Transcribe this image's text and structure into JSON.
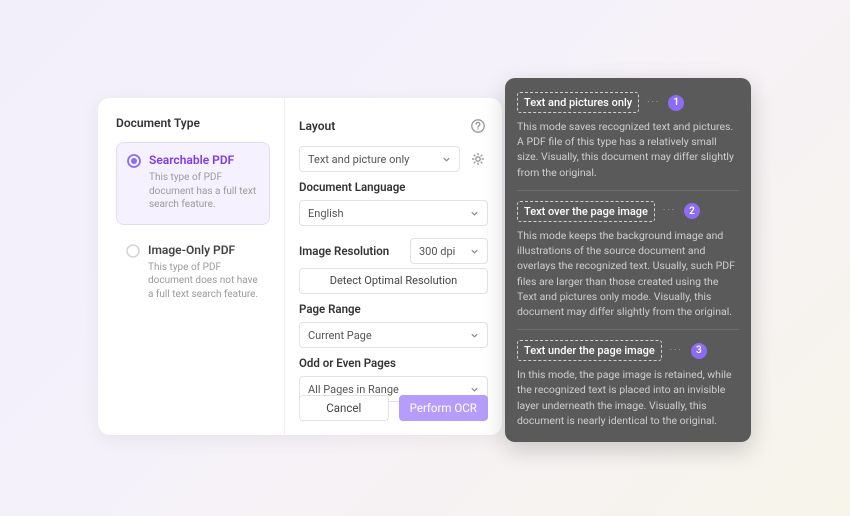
{
  "left": {
    "title": "Document Type",
    "options": [
      {
        "title": "Searchable PDF",
        "desc": "This type of PDF document has a full text search feature."
      },
      {
        "title": "Image-Only PDF",
        "desc": "This type of PDF document does not have a full text search feature."
      }
    ]
  },
  "right": {
    "layout_label": "Layout",
    "layout_value": "Text and picture only",
    "lang_label": "Document Language",
    "lang_value": "English",
    "res_label": "Image Resolution",
    "res_value": "300 dpi",
    "detect_btn": "Detect Optimal Resolution",
    "range_label": "Page Range",
    "range_value": "Current Page",
    "oddeven_label": "Odd or Even Pages",
    "oddeven_value": "All Pages in Range",
    "cancel": "Cancel",
    "perform": "Perform OCR"
  },
  "callout": {
    "items": [
      {
        "title": "Text and pictures only",
        "num": "1",
        "desc": "This mode saves recognized text and pictures. A PDF file of this type has a relatively small size. Visually, this document may differ slightly from the original."
      },
      {
        "title": "Text over the page image",
        "num": "2",
        "desc": "This mode keeps the background image and illustrations of the source document and overlays the recognized text. Usually, such PDF files are larger than those created using the Text and pictures only mode. Visually, this document may differ slightly from the original."
      },
      {
        "title": "Text under the page image",
        "num": "3",
        "desc": "In this mode, the page image is retained, while the recognized text is placed into an invisible layer underneath the image. Visually, this document is nearly identical to the original."
      }
    ]
  }
}
